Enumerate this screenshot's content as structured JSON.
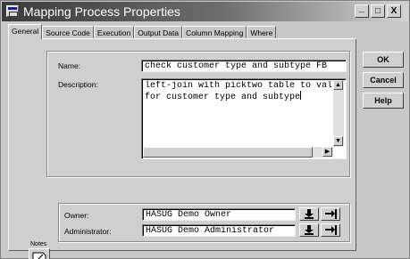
{
  "window": {
    "title": "Mapping Process Properties",
    "controls": [
      "minimize",
      "maximize",
      "close"
    ]
  },
  "tabs": [
    {
      "label": "General",
      "active": true
    },
    {
      "label": "Source Code",
      "active": false
    },
    {
      "label": "Execution",
      "active": false
    },
    {
      "label": "Output Data",
      "active": false
    },
    {
      "label": "Column Mapping",
      "active": false
    },
    {
      "label": "Where",
      "active": false
    }
  ],
  "general": {
    "name_label": "Name:",
    "name_value": "check customer type and subtype FB",
    "description_label": "Description:",
    "description_line1": "left-join with picktwo table to valid",
    "description_line2": "for customer type and subtype"
  },
  "notes": {
    "label": "Notes",
    "icon": "notes-icon"
  },
  "ownership": {
    "owner_label": "Owner:",
    "owner_value": "HASUG Demo Owner",
    "admin_label": "Administrator:",
    "admin_value": "HASUG Demo Administrator"
  },
  "buttons": {
    "ok": "OK",
    "cancel": "Cancel",
    "help": "Help"
  }
}
